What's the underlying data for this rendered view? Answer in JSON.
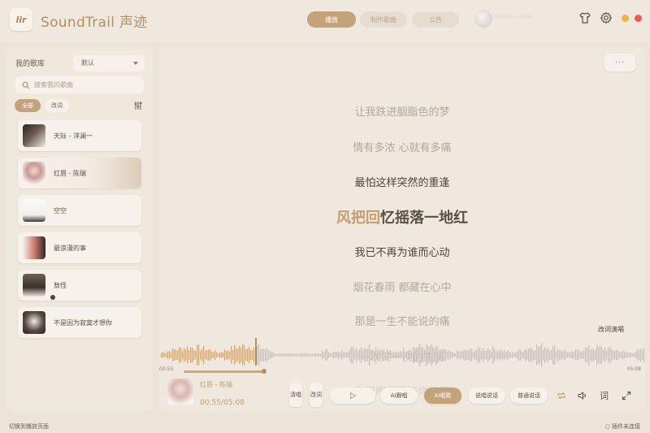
{
  "app": {
    "logo_text": "lir",
    "title": "SoundTrail 声迹"
  },
  "top_tabs": [
    {
      "label": "播放",
      "active": true
    },
    {
      "label": "制作歌曲",
      "active": false
    },
    {
      "label": "公告",
      "active": false
    }
  ],
  "user": {
    "name": "•••••• •••••"
  },
  "window_dots": {
    "minimize_color": "#f2b23a",
    "close_color": "#ef5a4c"
  },
  "sidebar": {
    "library_label": "我的歌库",
    "sort_value": "默认",
    "search_placeholder": "搜索我的歌曲",
    "filters": [
      {
        "label": "全部",
        "active": true
      },
      {
        "label": "改词",
        "active": false
      }
    ],
    "songs": [
      {
        "title": "天际 - 洋澜一",
        "active": false
      },
      {
        "title": "红唇 - 陈瑞",
        "active": true
      },
      {
        "title": "空空",
        "active": false
      },
      {
        "title": "最浪漫的事",
        "active": false
      },
      {
        "title": "敖怪",
        "active": false
      },
      {
        "title": "不是因为寂寞才想你",
        "active": false
      }
    ]
  },
  "lyrics": {
    "lines": [
      "让我跌进胭脂色的梦",
      "情有多浓 心就有多痛",
      "最怕这样突然的重逢",
      "我已不再为谁而心动",
      "烟花春雨 都藏在心中",
      "那是一生不能说的痛"
    ],
    "current_sung": "风把回",
    "current_rest": "忆摇落一地红",
    "faded_under_wave": "一次又一次的失落",
    "faded_under_bar": "你用眼泪装饰你的美"
  },
  "more_button": "···",
  "rap_label": "改词演唱",
  "waveform": {
    "time_left": "00:55",
    "time_right": "05:08",
    "progress": 0.18
  },
  "now_playing": {
    "title": "红唇 - 陈瑞",
    "time": "00:55/05:08"
  },
  "controls": {
    "clear_sing": "清唱",
    "change_lyric": "改词",
    "ai_accompany": "AI跟唱",
    "ai_sing": "AI唱歌",
    "rap_talk": "说唱说话",
    "normal_talk": "普通说话",
    "lyric_toggle": "词"
  },
  "status": {
    "left": "切换到播放页面",
    "right": "○ 插件未连接"
  }
}
